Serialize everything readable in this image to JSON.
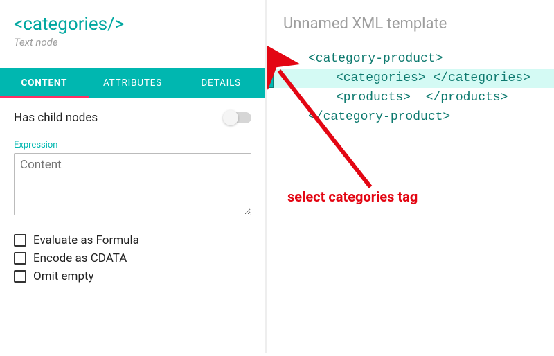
{
  "colors": {
    "accent": "#00b7b0",
    "tab_indicator": "#ff2e63",
    "callout": "#e30613"
  },
  "left": {
    "title": "<categories/>",
    "subtitle": "Text node",
    "tabs": [
      {
        "label": "CONTENT",
        "active": true
      },
      {
        "label": "ATTRIBUTES",
        "active": false
      },
      {
        "label": "DETAILS",
        "active": false
      }
    ],
    "has_child_label": "Has child nodes",
    "expression_label": "Expression",
    "expression_placeholder": "Content",
    "expression_value": "",
    "checks": [
      "Evaluate as Formula",
      "Encode as CDATA",
      "Omit empty"
    ]
  },
  "right": {
    "title": "Unnamed XML template",
    "lines": {
      "open_root": "<category-product>",
      "categories": "<categories> </categories>",
      "products": "<products>  </products>",
      "close_root": "</category-product>"
    }
  },
  "callout": {
    "text": "select categories tag"
  }
}
